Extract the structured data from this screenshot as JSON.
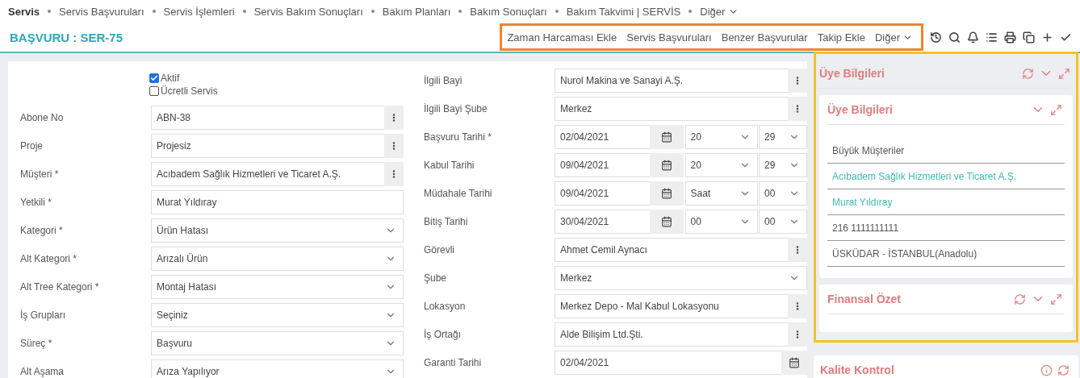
{
  "nav": [
    {
      "label": "Servis",
      "selected": true,
      "dropdown": false
    },
    {
      "label": "Servis Başvuruları",
      "selected": false,
      "dropdown": false
    },
    {
      "label": "Servis İşlemleri",
      "selected": false,
      "dropdown": false
    },
    {
      "label": "Servis Bakım Sonuçları",
      "selected": false,
      "dropdown": false
    },
    {
      "label": "Bakım Planları",
      "selected": false,
      "dropdown": false
    },
    {
      "label": "Bakım Sonuçları",
      "selected": false,
      "dropdown": false
    },
    {
      "label": "Bakım Takvimi | SERVİS",
      "selected": false,
      "dropdown": false
    },
    {
      "label": "Diğer",
      "selected": false,
      "dropdown": true
    }
  ],
  "header": {
    "title": "BAŞVURU : SER-75",
    "actions": [
      {
        "label": "Zaman Harcaması Ekle",
        "dropdown": false
      },
      {
        "label": "Servis Başvuruları",
        "dropdown": false
      },
      {
        "label": "Benzer Başvurular",
        "dropdown": false
      },
      {
        "label": "Takip Ekle",
        "dropdown": false
      },
      {
        "label": "Diğer",
        "dropdown": true
      }
    ]
  },
  "checkboxes": [
    {
      "label": "Aktif",
      "checked": true
    },
    {
      "label": "Ücretli Servis",
      "checked": false
    }
  ],
  "left_fields": [
    {
      "label": "Abone No",
      "kind": "lookup",
      "value": "ABN-38"
    },
    {
      "label": "Proje",
      "kind": "lookup",
      "value": "Projesiz"
    },
    {
      "label": "Müşteri *",
      "kind": "lookup",
      "value": "Acıbadem  Sağlık Hizmetleri ve Ticaret A.Ş."
    },
    {
      "label": "Yetkili *",
      "kind": "text",
      "value": "Murat Yıldıray"
    },
    {
      "label": "Kategori *",
      "kind": "select",
      "value": "Ürün Hatası"
    },
    {
      "label": "Alt Kategori *",
      "kind": "select",
      "value": "Arızalı Ürün"
    },
    {
      "label": "Alt Tree Kategori *",
      "kind": "select",
      "value": "Montaj Hatası"
    },
    {
      "label": "İş Grupları",
      "kind": "select",
      "value": "Seçiniz"
    },
    {
      "label": "Süreç *",
      "kind": "select",
      "value": "Başvuru"
    },
    {
      "label": "Alt Aşama",
      "kind": "select",
      "value": "Arıza Yapılıyor"
    }
  ],
  "right_fields": [
    {
      "label": "İlgili Bayi",
      "kind": "lookup",
      "value": "Nurol Makina ve Sanayi A.Ş."
    },
    {
      "label": "İlgili Bayi Şube",
      "kind": "lookup",
      "value": "Merkez"
    },
    {
      "label": "Başvuru Tarihi *",
      "kind": "datetime",
      "value": "02/04/2021",
      "hour": "20",
      "minute": "29"
    },
    {
      "label": "Kabul Tarihi",
      "kind": "datetime",
      "value": "09/04/2021",
      "hour": "20",
      "minute": "29"
    },
    {
      "label": "Müdahale Tarihi",
      "kind": "datetime",
      "value": "09/04/2021",
      "hour": "Saat",
      "minute": "00"
    },
    {
      "label": "Bitiş Tarihi",
      "kind": "datetime",
      "value": "30/04/2021",
      "hour": "00",
      "minute": "00"
    },
    {
      "label": "Görevli",
      "kind": "lookup",
      "value": "Ahmet Cemil Aynacı"
    },
    {
      "label": "Şube",
      "kind": "select",
      "value": "Merkez"
    },
    {
      "label": "Lokasyon",
      "kind": "lookup",
      "value": "Merkez Depo - Mal Kabul Lokasyonu"
    },
    {
      "label": "İş Ortağı",
      "kind": "lookup",
      "value": "Alde Bilişim Ltd.Şti."
    },
    {
      "label": "Garanti Tarihi",
      "kind": "date",
      "value": "02/04/2021"
    }
  ],
  "side_panel": {
    "title": "Üye Bilgileri",
    "inner_cards": [
      {
        "title": "Üye Bilgileri",
        "refresh": false,
        "rows": [
          {
            "text": "Büyük Müşteriler",
            "link": false
          },
          {
            "text": "Acıbadem Sağlık Hizmetleri ve Ticaret A.Ş.",
            "link": true
          },
          {
            "text": "Murat Yıldıray",
            "link": true
          },
          {
            "text": "216 1111111111",
            "link": false
          },
          {
            "text": "ÜSKÜDAR - İSTANBUL(Anadolu)",
            "link": false
          }
        ]
      },
      {
        "title": "Finansal Özet",
        "refresh": true
      }
    ]
  },
  "next_panel": {
    "title": "Kalite Kontrol"
  }
}
